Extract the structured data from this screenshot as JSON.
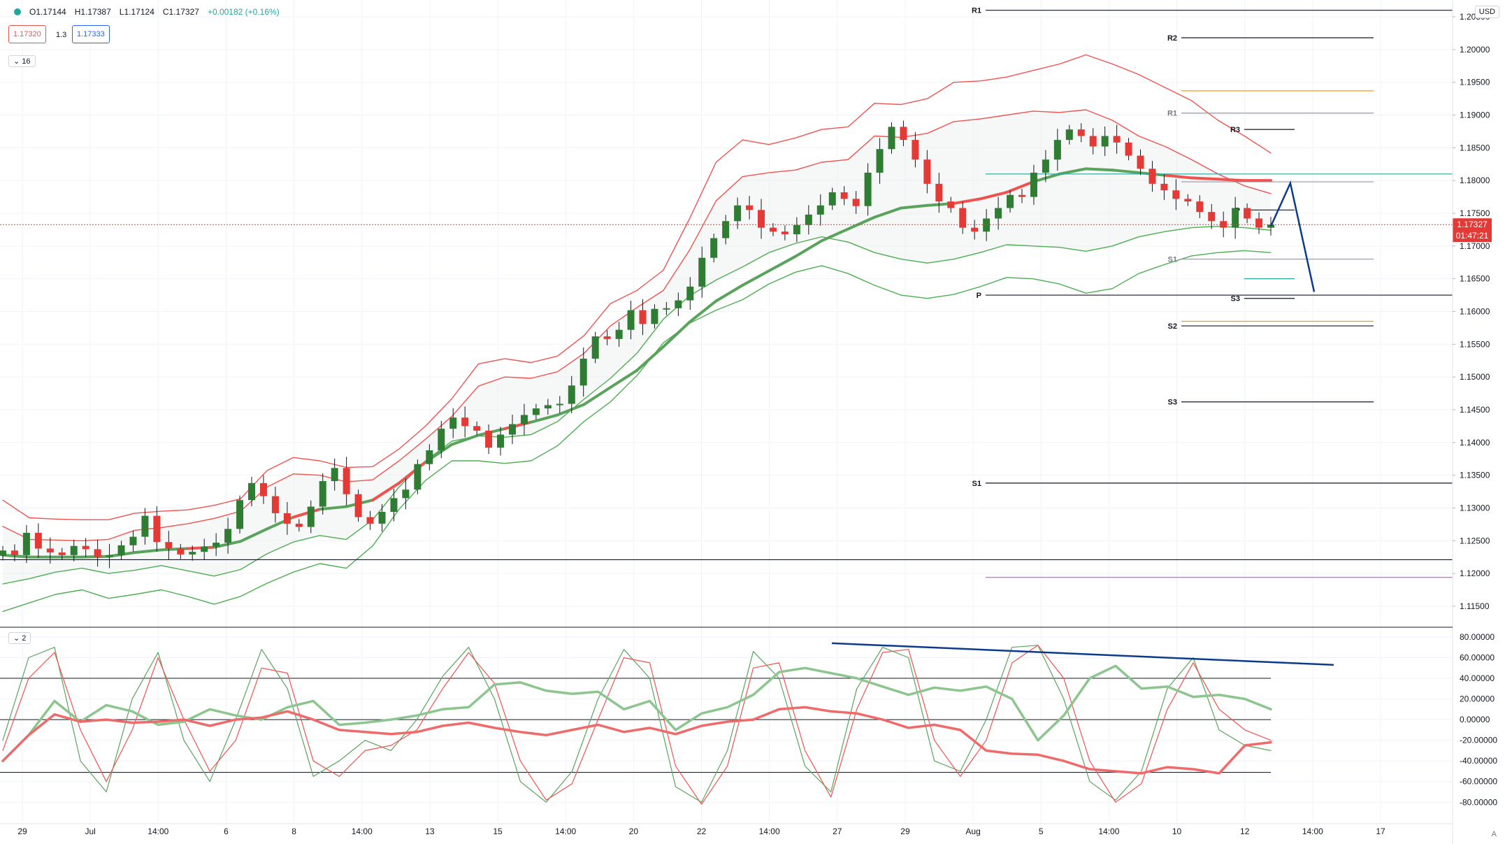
{
  "header": {
    "ohlc": [
      {
        "label": "O",
        "value": "1.17144"
      },
      {
        "label": "H",
        "value": "1.17387"
      },
      {
        "label": "L",
        "value": "1.17124"
      },
      {
        "label": "C",
        "value": "1.17327"
      }
    ],
    "change": "+0.00182 (+0.16%)",
    "sell_price": "1.17320",
    "spread": "1.3",
    "buy_price": "1.17333",
    "main_collapse": "16",
    "osc_collapse": "2",
    "currency": "USD",
    "corner": "A"
  },
  "colors": {
    "up": "#26a69a",
    "candle_up": "#2e7d32",
    "candle_down": "#e53935",
    "band_red": "#ef5350",
    "band_green": "#4caf50",
    "level_black": "#131722",
    "orange": "#ff9800",
    "teal": "#26a69a",
    "magenta": "#e040fb",
    "blue": "#0d3b8c",
    "price_label": "#e53935"
  },
  "chart_data": [
    {
      "type": "candlestick",
      "title": "",
      "y_axis": {
        "ylim": [
          1.112,
          1.2065
        ],
        "ticks": [
          "1.20500",
          "1.20000",
          "1.19500",
          "1.19000",
          "1.18500",
          "1.18000",
          "1.17500",
          "1.17000",
          "1.16500",
          "1.16000",
          "1.15500",
          "1.15000",
          "1.14500",
          "1.14000",
          "1.13500",
          "1.13000",
          "1.12500",
          "1.12000",
          "1.11500"
        ]
      },
      "x_axis": {
        "ticks": [
          "29",
          "Jul",
          "14:00",
          "6",
          "8",
          "14:00",
          "13",
          "15",
          "14:00",
          "20",
          "22",
          "14:00",
          "27",
          "29",
          "Aug",
          "5",
          "14:00",
          "10",
          "12",
          "14:00",
          "17"
        ]
      },
      "current_price": {
        "value": 1.17327,
        "label": "1.17327",
        "countdown": "01:47:21"
      },
      "horizontal_levels": [
        {
          "label": "R1",
          "value": 1.206,
          "color": "black",
          "span": "long"
        },
        {
          "label": "R2",
          "value": 1.2018,
          "color": "black",
          "span": "short"
        },
        {
          "label": "",
          "value": 1.1937,
          "color": "orange",
          "span": "short"
        },
        {
          "label": "R1",
          "value": 1.1903,
          "color": "gray",
          "span": "short"
        },
        {
          "label": "R3",
          "value": 1.1878,
          "color": "black",
          "span": "tiny"
        },
        {
          "label": "",
          "value": 1.181,
          "color": "teal",
          "span": "long"
        },
        {
          "label": "",
          "value": 1.1798,
          "color": "gray",
          "span": "short"
        },
        {
          "label": "P",
          "value": 1.1755,
          "color": "black",
          "span": "tiny"
        },
        {
          "label": "S1",
          "value": 1.168,
          "color": "gray",
          "span": "short"
        },
        {
          "label": "",
          "value": 1.165,
          "color": "teal",
          "span": "tiny"
        },
        {
          "label": "P",
          "value": 1.1625,
          "color": "black",
          "span": "long"
        },
        {
          "label": "S3",
          "value": 1.162,
          "color": "black",
          "span": "tiny"
        },
        {
          "label": "",
          "value": 1.1585,
          "color": "orange",
          "span": "short"
        },
        {
          "label": "S2",
          "value": 1.1578,
          "color": "black",
          "span": "short"
        },
        {
          "label": "S3",
          "value": 1.1462,
          "color": "black",
          "span": "short"
        },
        {
          "label": "S1",
          "value": 1.1338,
          "color": "black",
          "span": "long"
        },
        {
          "label": "",
          "value": 1.1221,
          "color": "black",
          "span": "full"
        },
        {
          "label": "",
          "value": 1.1194,
          "color": "magenta",
          "span": "long"
        }
      ],
      "close_path": [
        1.1235,
        1.1228,
        1.1262,
        1.1238,
        1.1232,
        1.1228,
        1.1242,
        1.1237,
        1.1225,
        1.1228,
        1.1243,
        1.1256,
        1.1288,
        1.1248,
        1.1238,
        1.1229,
        1.1233,
        1.1241,
        1.1247,
        1.1268,
        1.1312,
        1.1338,
        1.1318,
        1.1292,
        1.1276,
        1.1271,
        1.1302,
        1.1341,
        1.1361,
        1.1321,
        1.1286,
        1.1276,
        1.1294,
        1.1315,
        1.1328,
        1.1367,
        1.1388,
        1.1421,
        1.1438,
        1.1425,
        1.1418,
        1.1392,
        1.1412,
        1.1428,
        1.1442,
        1.1452,
        1.1457,
        1.1459,
        1.1487,
        1.1528,
        1.1562,
        1.1558,
        1.1572,
        1.1602,
        1.1581,
        1.1604,
        1.1605,
        1.1617,
        1.1638,
        1.1682,
        1.1712,
        1.1738,
        1.1762,
        1.1755,
        1.1728,
        1.1722,
        1.1718,
        1.1732,
        1.1748,
        1.1762,
        1.1782,
        1.1772,
        1.1761,
        1.1812,
        1.1848,
        1.1882,
        1.1862,
        1.1832,
        1.1795,
        1.1768,
        1.1758,
        1.1728,
        1.1722,
        1.1742,
        1.1758,
        1.1778,
        1.1775,
        1.1812,
        1.1832,
        1.1862,
        1.1878,
        1.1868,
        1.1852,
        1.1868,
        1.1858,
        1.1838,
        1.1818,
        1.1795,
        1.1785,
        1.1772,
        1.1768,
        1.1752,
        1.1738,
        1.1728,
        1.1758,
        1.1742,
        1.1728,
        1.17327
      ],
      "bollinger_outer": {
        "upper": [
          1.1312,
          1.1285,
          1.1283,
          1.1282,
          1.1282,
          1.1292,
          1.1295,
          1.1297,
          1.1304,
          1.1314,
          1.1357,
          1.1377,
          1.1372,
          1.1362,
          1.1363,
          1.139,
          1.1425,
          1.1467,
          1.152,
          1.1528,
          1.1522,
          1.1532,
          1.1563,
          1.1612,
          1.1632,
          1.1663,
          1.1742,
          1.1828,
          1.1862,
          1.1855,
          1.1865,
          1.1878,
          1.1882,
          1.1918,
          1.1916,
          1.1925,
          1.195,
          1.1952,
          1.1958,
          1.1968,
          1.1978,
          1.1992,
          1.1978,
          1.1962,
          1.1942,
          1.1922,
          1.1892,
          1.1868,
          1.1842
        ],
        "lower": [
          1.1142,
          1.1155,
          1.1168,
          1.1175,
          1.1162,
          1.1168,
          1.1175,
          1.1165,
          1.1153,
          1.1165,
          1.1185,
          1.1202,
          1.1215,
          1.1208,
          1.1242,
          1.1298,
          1.1342,
          1.1372,
          1.1372,
          1.1368,
          1.1372,
          1.1395,
          1.1432,
          1.1462,
          1.1502,
          1.1552,
          1.1582,
          1.1602,
          1.1618,
          1.1642,
          1.166,
          1.167,
          1.1658,
          1.164,
          1.1625,
          1.162,
          1.1626,
          1.1638,
          1.1652,
          1.165,
          1.1642,
          1.1628,
          1.1635,
          1.1658,
          1.1672,
          1.1685,
          1.169,
          1.1693,
          1.169
        ]
      },
      "bollinger_inner": {
        "upper": [
          1.1272,
          1.1252,
          1.1251,
          1.125,
          1.1252,
          1.1266,
          1.127,
          1.1276,
          1.1284,
          1.1295,
          1.1332,
          1.1352,
          1.135,
          1.134,
          1.1343,
          1.1372,
          1.1405,
          1.144,
          1.1486,
          1.15,
          1.1498,
          1.1508,
          1.1536,
          1.1578,
          1.1606,
          1.1632,
          1.1694,
          1.1769,
          1.1806,
          1.1812,
          1.1816,
          1.1828,
          1.1832,
          1.1868,
          1.1866,
          1.1872,
          1.189,
          1.1894,
          1.19,
          1.1906,
          1.1904,
          1.1908,
          1.1892,
          1.1868,
          1.1852,
          1.1832,
          1.181,
          1.1792,
          1.178
        ],
        "lower": [
          1.1184,
          1.1192,
          1.1202,
          1.1208,
          1.12,
          1.1205,
          1.1212,
          1.1204,
          1.1196,
          1.1206,
          1.123,
          1.1248,
          1.1258,
          1.1252,
          1.1282,
          1.1332,
          1.1372,
          1.1402,
          1.141,
          1.1408,
          1.1412,
          1.1432,
          1.1466,
          1.1498,
          1.1536,
          1.1588,
          1.1624,
          1.1648,
          1.1668,
          1.169,
          1.1704,
          1.1714,
          1.1706,
          1.169,
          1.168,
          1.1674,
          1.168,
          1.169,
          1.1702,
          1.17,
          1.1698,
          1.1692,
          1.17,
          1.1714,
          1.1722,
          1.1728,
          1.173,
          1.1728,
          1.1724
        ]
      },
      "ma_line": [
        1.1228,
        1.1225,
        1.1225,
        1.1225,
        1.1226,
        1.1232,
        1.1236,
        1.1238,
        1.124,
        1.1249,
        1.1268,
        1.1286,
        1.1298,
        1.1302,
        1.1312,
        1.1338,
        1.137,
        1.1397,
        1.1411,
        1.1421,
        1.1431,
        1.1442,
        1.1458,
        1.1484,
        1.151,
        1.1546,
        1.1584,
        1.1616,
        1.164,
        1.1662,
        1.1684,
        1.1708,
        1.1726,
        1.1744,
        1.1758,
        1.1762,
        1.1765,
        1.1772,
        1.1782,
        1.1798,
        1.181,
        1.1818,
        1.1816,
        1.1812,
        1.1808,
        1.1804,
        1.1802,
        1.18,
        1.18
      ],
      "projection": [
        {
          "t": 0.0,
          "value": 1.173
        },
        {
          "t": 0.45,
          "value": 1.1796
        },
        {
          "t": 1.0,
          "value": 1.163
        }
      ]
    },
    {
      "type": "line",
      "title": "",
      "ylim": [
        -92,
        82
      ],
      "y_ticks": [
        "80.00000",
        "60.00000",
        "40.00000",
        "20.00000",
        "0.00000",
        "-20.00000",
        "-40.00000",
        "-60.00000",
        "-80.00000"
      ],
      "reference_lines": [
        40,
        0,
        -51
      ],
      "series": [
        {
          "color": "green_thick",
          "values": [
            -40,
            -15,
            18,
            -2,
            14,
            8,
            -5,
            -2,
            10,
            4,
            0,
            12,
            18,
            -5,
            -3,
            0,
            4,
            10,
            12,
            34,
            36,
            28,
            25,
            27,
            10,
            18,
            -10,
            6,
            12,
            24,
            46,
            50,
            45,
            40,
            32,
            24,
            31,
            28,
            32,
            20,
            -20,
            4,
            40,
            52,
            30,
            32,
            22,
            24,
            20,
            10
          ]
        },
        {
          "color": "red_thick",
          "values": [
            -40,
            -15,
            5,
            -2,
            0,
            -3,
            -2,
            0,
            -6,
            0,
            2,
            8,
            0,
            -10,
            -12,
            -14,
            -12,
            -6,
            -3,
            -8,
            -12,
            -15,
            -10,
            -5,
            -12,
            -8,
            -14,
            -6,
            -2,
            0,
            10,
            12,
            8,
            6,
            0,
            -8,
            -5,
            -10,
            -30,
            -33,
            -34,
            -40,
            -48,
            -50,
            -52,
            -46,
            -48,
            -52,
            -25,
            -22
          ]
        },
        {
          "color": "green_thin",
          "values": [
            -20,
            60,
            70,
            -40,
            -70,
            20,
            65,
            -20,
            -60,
            0,
            68,
            30,
            -55,
            -40,
            -20,
            -30,
            0,
            42,
            70,
            20,
            -60,
            -80,
            -50,
            20,
            68,
            40,
            -65,
            -80,
            -30,
            66,
            40,
            -45,
            -70,
            30,
            70,
            60,
            -40,
            -50,
            0,
            70,
            72,
            20,
            -60,
            -78,
            -50,
            30,
            60,
            -10,
            -25,
            -30
          ]
        },
        {
          "color": "red_thin",
          "values": [
            -30,
            40,
            65,
            -10,
            -60,
            -10,
            60,
            0,
            -50,
            -20,
            50,
            45,
            -40,
            -55,
            -30,
            -25,
            -10,
            30,
            65,
            35,
            -40,
            -78,
            -62,
            0,
            60,
            55,
            -45,
            -82,
            -45,
            50,
            55,
            -30,
            -75,
            10,
            65,
            68,
            -20,
            -55,
            -20,
            55,
            72,
            40,
            -40,
            -80,
            -62,
            10,
            55,
            10,
            -10,
            -20
          ]
        }
      ],
      "trend_line": [
        {
          "t": 0.0,
          "value": 74
        },
        {
          "t": 1.0,
          "value": 53
        }
      ]
    }
  ]
}
